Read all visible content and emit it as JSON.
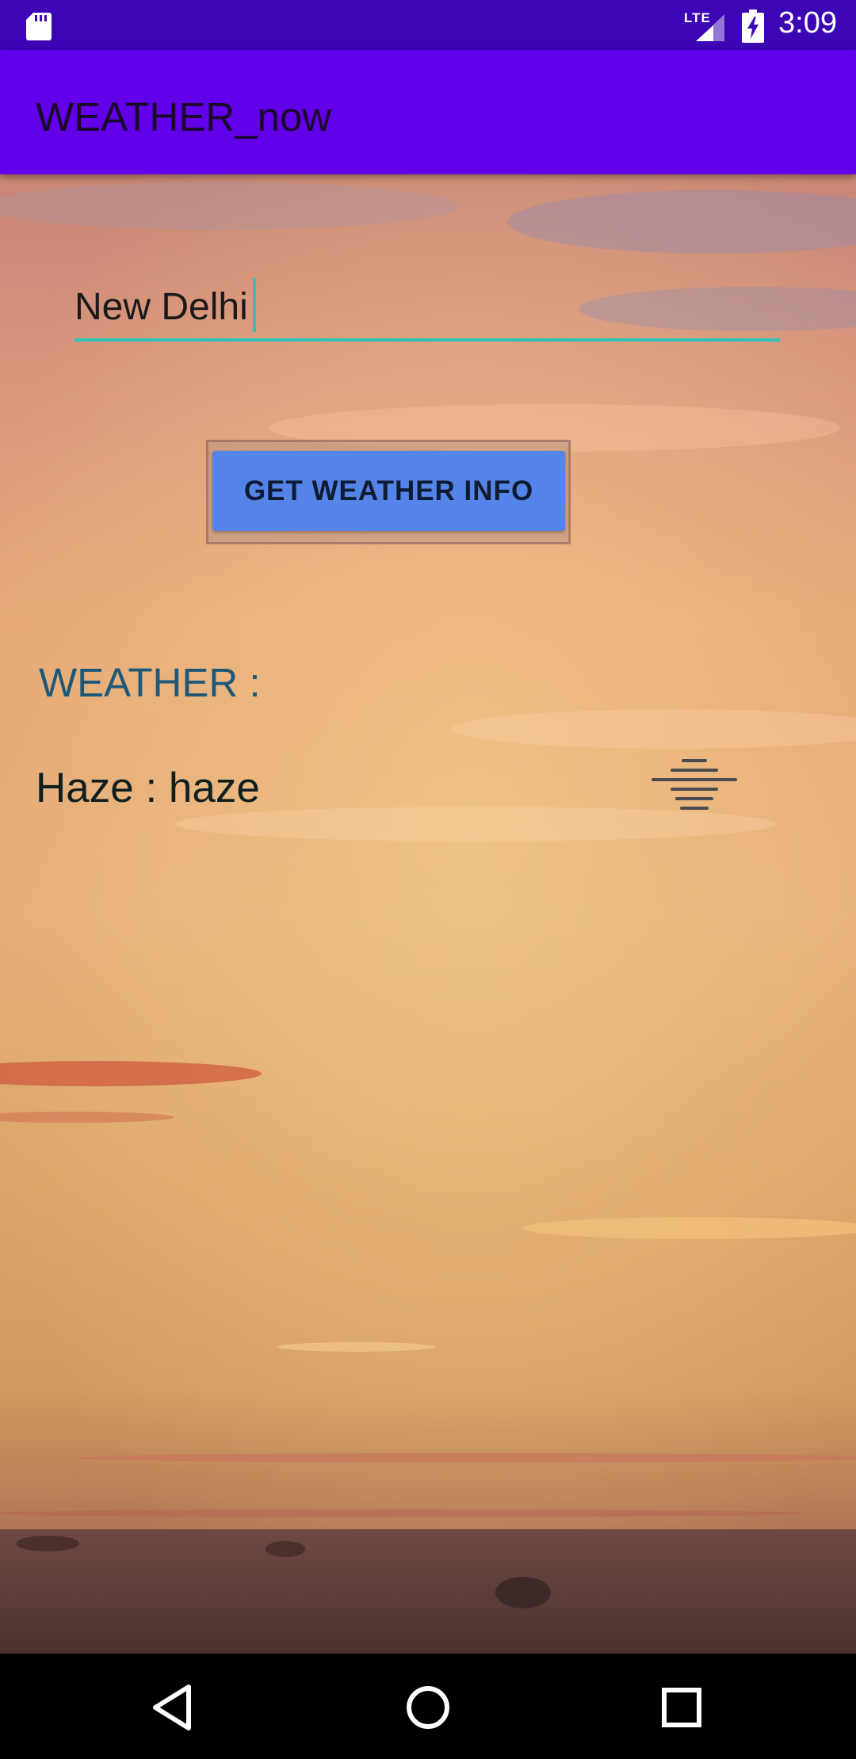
{
  "status_bar": {
    "time": "3:09",
    "network": "LTE",
    "icons": [
      "sd-card-icon",
      "signal-icon",
      "battery-charging-icon"
    ]
  },
  "app_bar": {
    "title": "WEATHER_now"
  },
  "search": {
    "value": "New Delhi",
    "placeholder": ""
  },
  "actions": {
    "get_weather_label": "GET WEATHER INFO"
  },
  "weather": {
    "heading": "WEATHER :",
    "description": "Haze : haze",
    "icon": "haze-icon"
  },
  "nav_bar": {
    "icons": [
      "back-icon",
      "home-icon",
      "recents-icon"
    ]
  },
  "colors": {
    "status_bar": "#3c06b4",
    "app_bar": "#6200ea",
    "accent": "#2ec4b6",
    "button": "#5584e8",
    "heading_text": "#1e5878"
  }
}
